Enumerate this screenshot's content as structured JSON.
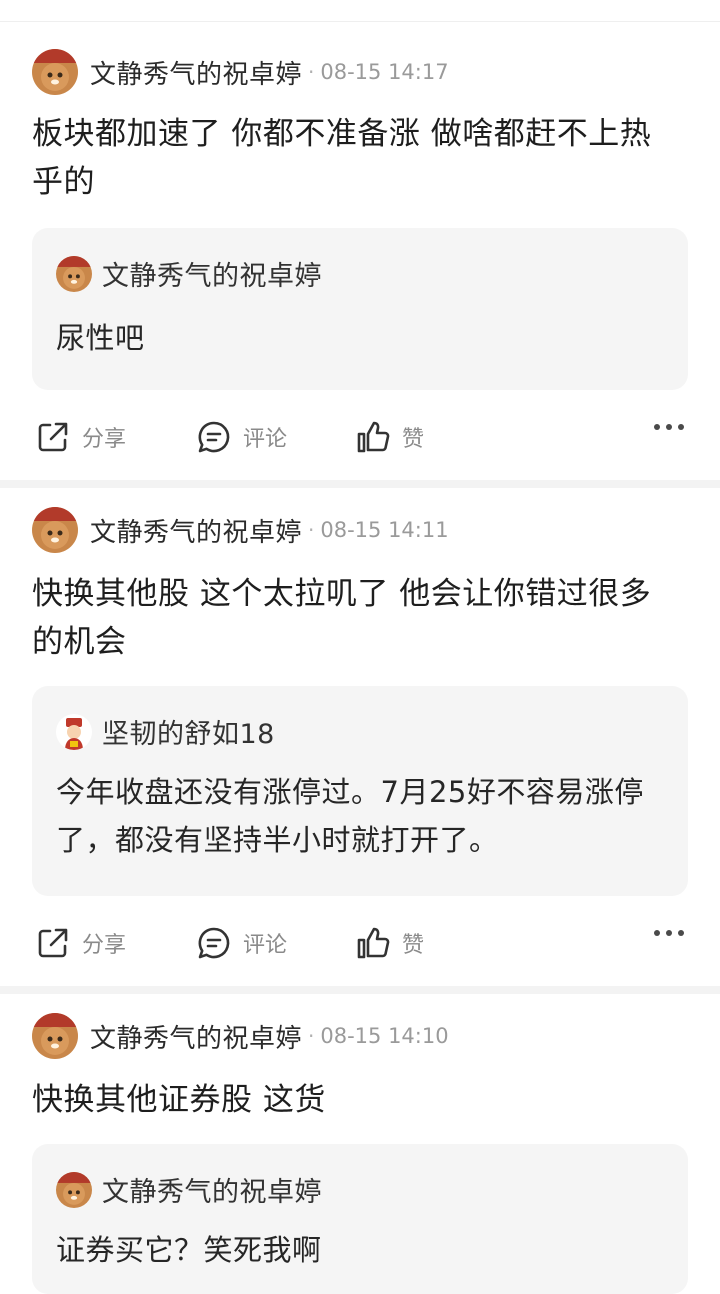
{
  "posts": [
    {
      "author": "文静秀气的祝卓婷",
      "time": "08-15 14:17",
      "content": "板块都加速了 你都不准备涨 做啥都赶不上热乎的",
      "quote": {
        "author": "文静秀气的祝卓婷",
        "text": "尿性吧",
        "avatar": "cat-avatar"
      }
    },
    {
      "author": "文静秀气的祝卓婷",
      "time": "08-15 14:11",
      "content": "快换其他股 这个太拉叽了 他会让你错过很多的机会",
      "quote": {
        "author": "坚韧的舒如18",
        "text": "今年收盘还没有涨停过。7月25好不容易涨停了，都没有坚持半小时就打开了。",
        "avatar": "fortune-god-avatar"
      }
    },
    {
      "author": "文静秀气的祝卓婷",
      "time": "08-15 14:10",
      "content": "快换其他证券股 这货",
      "quote": {
        "author": "文静秀气的祝卓婷",
        "text": "证券买它？笑死我啊",
        "avatar": "cat-avatar"
      }
    }
  ],
  "actions": {
    "share": "分享",
    "comment": "评论",
    "like": "赞"
  },
  "separator": "·",
  "colors": {
    "quote_bg": "#f5f5f5",
    "meta": "#9a9a9a",
    "divider": "#f3f3f3"
  }
}
